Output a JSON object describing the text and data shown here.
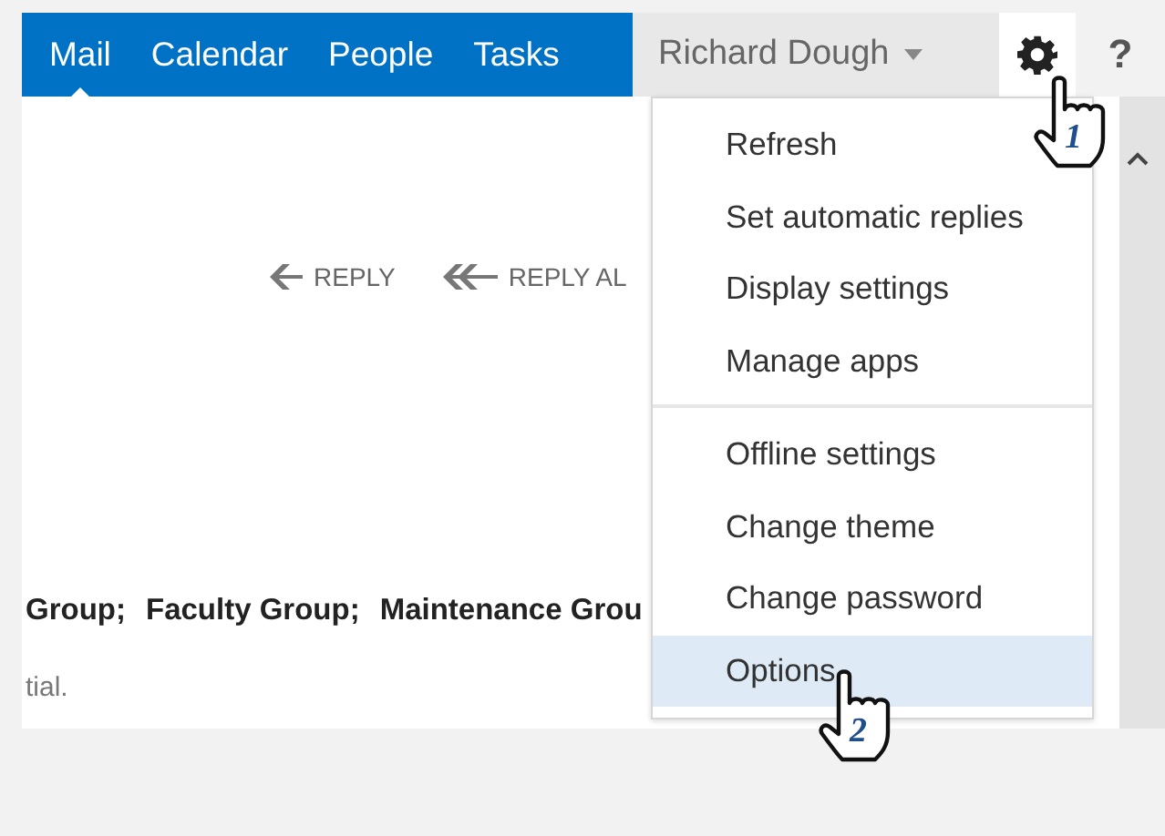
{
  "nav": {
    "tabs": [
      {
        "label": "Mail",
        "selected": true
      },
      {
        "label": "Calendar",
        "selected": false
      },
      {
        "label": "People",
        "selected": false
      },
      {
        "label": "Tasks",
        "selected": false
      }
    ],
    "user": "Richard Dough",
    "help": "?"
  },
  "message": {
    "actions": [
      {
        "label": "REPLY",
        "kind": "reply"
      },
      {
        "label": "REPLY AL",
        "kind": "reply-all"
      }
    ],
    "recipients": [
      "Group;",
      "Faculty Group;",
      "Maintenance Grou"
    ],
    "body": "tial."
  },
  "menu": {
    "groups": [
      [
        {
          "label": "Refresh",
          "selected": false
        },
        {
          "label": "Set automatic replies",
          "selected": false
        },
        {
          "label": "Display settings",
          "selected": false
        },
        {
          "label": "Manage apps",
          "selected": false
        }
      ],
      [
        {
          "label": "Offline settings",
          "selected": false
        },
        {
          "label": "Change theme",
          "selected": false
        },
        {
          "label": "Change password",
          "selected": false
        },
        {
          "label": "Options",
          "selected": true
        }
      ]
    ]
  },
  "annotations": [
    {
      "label": "1"
    },
    {
      "label": "2"
    }
  ]
}
